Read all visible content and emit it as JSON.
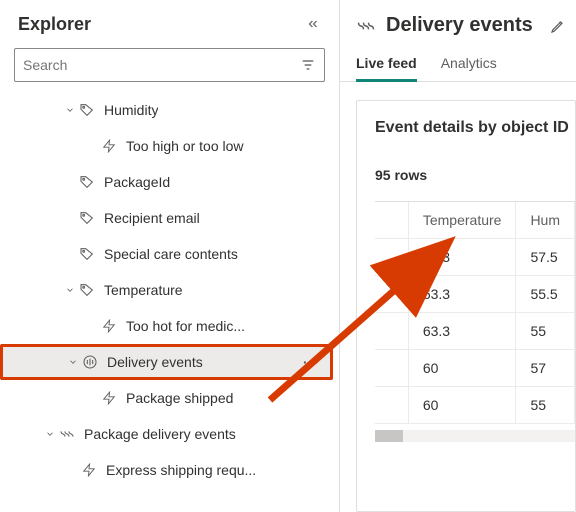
{
  "sidebar": {
    "title": "Explorer",
    "search_placeholder": "Search",
    "nodes": {
      "humidity": "Humidity",
      "humidity_child": "Too high or too low",
      "packageid": "PackageId",
      "recipient": "Recipient email",
      "special": "Special care contents",
      "temperature": "Temperature",
      "temperature_child": "Too hot for medic...",
      "delivery_events": "Delivery events",
      "delivery_events_child": "Package shipped",
      "pkg_delivery_events": "Package delivery events",
      "express": "Express shipping requ..."
    },
    "more": "···"
  },
  "main": {
    "title": "Delivery events",
    "tabs": {
      "live": "Live feed",
      "analytics": "Analytics"
    },
    "card": {
      "title": "Event details by object ID",
      "rows_label": "95 rows",
      "columns": {
        "temp": "Temperature",
        "hum": "Hum"
      }
    }
  },
  "chart_data": {
    "type": "table",
    "columns": [
      "Temperature",
      "Humidity"
    ],
    "rows": [
      [
        63.3,
        57.5
      ],
      [
        63.3,
        55.5
      ],
      [
        63.3,
        55
      ],
      [
        60,
        57
      ],
      [
        60,
        55
      ]
    ],
    "row_count": 95
  }
}
